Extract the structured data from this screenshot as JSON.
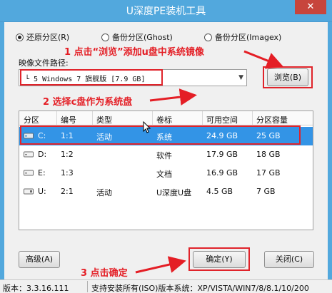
{
  "window": {
    "title": "U深度PE装机工具",
    "close_glyph": "✕"
  },
  "mode_options": [
    {
      "label": "还原分区(R)",
      "selected": true
    },
    {
      "label": "备份分区(Ghost)",
      "selected": false
    },
    {
      "label": "备份分区(Imagex)",
      "selected": false
    }
  ],
  "image_path": {
    "label": "映像文件路径:",
    "value": "└ 5 Windows 7 旗舰版 [7.9 GB]",
    "browse_label": "浏览(B)"
  },
  "partition_table": {
    "columns": [
      "分区",
      "编号",
      "类型",
      "卷标",
      "可用空间",
      "分区容量"
    ],
    "rows": [
      {
        "drive": "C:",
        "number": "1:1",
        "type": "活动",
        "label": "系统",
        "free": "24.9 GB",
        "capacity": "25 GB",
        "icon": "hard-disk-icon",
        "selected": true
      },
      {
        "drive": "D:",
        "number": "1:2",
        "type": "",
        "label": "软件",
        "free": "17.9 GB",
        "capacity": "18 GB",
        "icon": "hard-disk-icon",
        "selected": false
      },
      {
        "drive": "E:",
        "number": "1:3",
        "type": "",
        "label": "文档",
        "free": "16.9 GB",
        "capacity": "17 GB",
        "icon": "hard-disk-icon",
        "selected": false
      },
      {
        "drive": "U:",
        "number": "2:1",
        "type": "活动",
        "label": "U深度U盘",
        "free": "4.5 GB",
        "capacity": "7 GB",
        "icon": "usb-disk-icon",
        "selected": false
      }
    ]
  },
  "buttons": {
    "advanced": "高级(A)",
    "confirm": "确定(Y)",
    "close": "关闭(C)"
  },
  "annotations": {
    "step1": "1 点击“浏览”添加u盘中系统镜像",
    "step2": "2 选择c盘作为系统盘",
    "step3": "3 点击确定"
  },
  "status_bar": {
    "version": "版本：3.3.16.111",
    "support": "支持安装所有(ISO)版本系统：XP/VISTA/WIN7/8/8.1/10/200"
  },
  "colors": {
    "titlebar": "#52a8dd",
    "selection": "#3394e6",
    "annotation": "#e41e25"
  }
}
